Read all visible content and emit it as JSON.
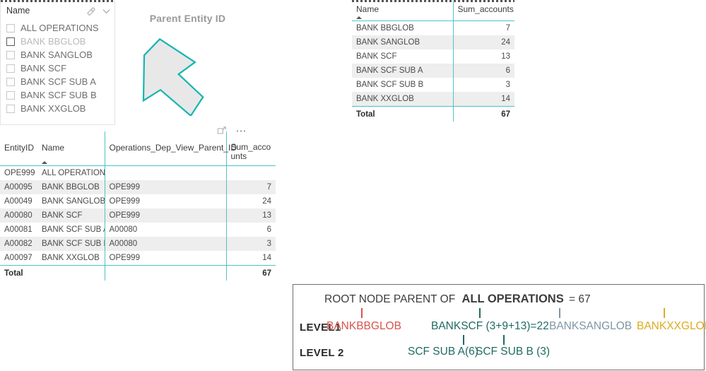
{
  "slicer": {
    "title": "Name",
    "icons": {
      "eraser": "eraser-icon",
      "chevron": "chevron-down-icon"
    },
    "items": [
      {
        "label": "ALL OPERATIONS",
        "checked": false,
        "hover": false
      },
      {
        "label": "BANK BBGLOB",
        "checked": false,
        "hover": true
      },
      {
        "label": "BANK SANGLOB",
        "checked": false,
        "hover": false
      },
      {
        "label": "BANK SCF",
        "checked": false,
        "hover": false
      },
      {
        "label": "BANK SCF SUB A",
        "checked": false,
        "hover": false
      },
      {
        "label": "BANK SCF SUB B",
        "checked": false,
        "hover": false
      },
      {
        "label": "BANK XXGLOB",
        "checked": false,
        "hover": false
      }
    ]
  },
  "annotation": {
    "caption": "Parent Entity ID",
    "arrow_icon": "down-left-arrow-icon",
    "arrow_fill": "#e8e8e8",
    "arrow_stroke": "#16b5b0"
  },
  "matrix": {
    "columns": [
      "Name",
      "Sum_accounts"
    ],
    "sort_column": "Name",
    "rows": [
      {
        "name": "BANK BBGLOB",
        "sum": "7"
      },
      {
        "name": "BANK SANGLOB",
        "sum": "24"
      },
      {
        "name": "BANK SCF",
        "sum": "13"
      },
      {
        "name": "BANK SCF SUB A",
        "sum": "6"
      },
      {
        "name": "BANK SCF SUB B",
        "sum": "3"
      },
      {
        "name": "BANK XXGLOB",
        "sum": "14"
      }
    ],
    "total_label": "Total",
    "total_value": "67"
  },
  "table": {
    "columns": [
      "EntityID",
      "Name",
      "Operations_Dep_View_Parent_ID",
      "Sum_accounts"
    ],
    "header_wrap": {
      "c4_line1": "Sum_acco",
      "c4_line2": "unts"
    },
    "sort_column": "Name",
    "tools": {
      "focus": "focus-mode-icon",
      "more": "more-options-icon"
    },
    "rows": [
      {
        "id": "OPE999",
        "name": "ALL OPERATIONS",
        "parent": "",
        "sum": ""
      },
      {
        "id": "A00095",
        "name": "BANK BBGLOB",
        "parent": "OPE999",
        "sum": "7"
      },
      {
        "id": "A00049",
        "name": "BANK SANGLOB",
        "parent": "OPE999",
        "sum": "24"
      },
      {
        "id": "A00080",
        "name": "BANK SCF",
        "parent": "OPE999",
        "sum": "13"
      },
      {
        "id": "A00081",
        "name": "BANK SCF SUB A",
        "parent": "A00080",
        "sum": "6"
      },
      {
        "id": "A00082",
        "name": "BANK SCF SUB B",
        "parent": "A00080",
        "sum": "3"
      },
      {
        "id": "A00097",
        "name": "BANK XXGLOB",
        "parent": "OPE999",
        "sum": "14"
      }
    ],
    "total_label": "Total",
    "total_value": "67"
  },
  "diagram": {
    "root_prefix": "ROOT NODE PARENT OF",
    "root_name": "ALL OPERATIONS",
    "root_value": "= 67",
    "level1_label": "LEVEL1",
    "level2_label": "LEVEL 2",
    "level1_nodes": [
      {
        "text": "BANKBBGLOB",
        "color": "#d9534f"
      },
      {
        "text": "BANKSCF (3+9+13)=22",
        "color": "#1f6b63"
      },
      {
        "text": "BANKSANGLOB",
        "color": "#7f96a6"
      },
      {
        "text": "BANKXXGLOB",
        "color": "#ddaa22"
      }
    ],
    "level2_nodes": [
      {
        "text": "SCF SUB A(6)",
        "color": "#1f6b63"
      },
      {
        "text": "SCF SUB B (3)",
        "color": "#1f6b63"
      }
    ]
  },
  "colors": {
    "accent_teal": "#4fc3c3",
    "arrow_teal": "#16b5b0",
    "row_alt": "#eeeeee",
    "text": "#4a4a4a"
  }
}
